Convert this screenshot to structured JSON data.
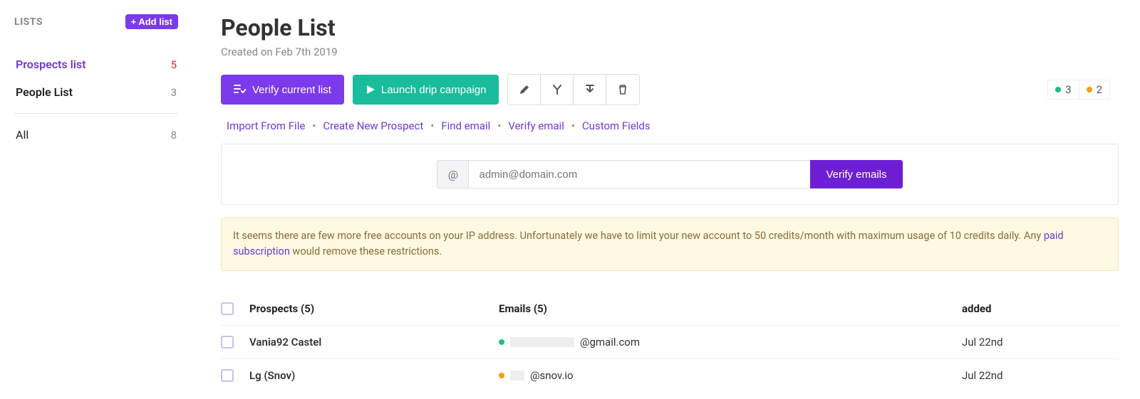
{
  "sidebar": {
    "title": "LISTS",
    "add_button": "+ Add list",
    "lists": [
      {
        "label": "Prospects list",
        "count": "5",
        "active": true
      },
      {
        "label": "People List",
        "count": "3",
        "active": false
      }
    ],
    "all_label": "All",
    "all_count": "8"
  },
  "page": {
    "title": "People List",
    "subtitle": "Created on Feb 7th 2019"
  },
  "toolbar": {
    "verify_label": "Verify current list",
    "launch_label": "Launch drip campaign"
  },
  "status_badges": {
    "green": "3",
    "orange": "2"
  },
  "sub_links": [
    "Import From File",
    "Create New Prospect",
    "Find email",
    "Verify email",
    "Custom Fields"
  ],
  "verify_box": {
    "at": "@",
    "placeholder": "admin@domain.com",
    "button": "Verify emails"
  },
  "alert": {
    "before_link": "It seems there are few more free accounts on your IP address. Unfortunately we have to limit your new account to 50 credits/month with maximum usage of 10 credits daily. Any ",
    "link_text": "paid subscription",
    "after_link": " would remove these restrictions."
  },
  "table": {
    "header": {
      "prospects": "Prospects (5)",
      "emails": "Emails (5)",
      "added": "added"
    },
    "rows": [
      {
        "name": "Vania92 Castel",
        "email_suffix": "@gmail.com",
        "status": "green",
        "added": "Jul 22nd"
      },
      {
        "name": "Lg (Snov)",
        "email_suffix": "@snov.io",
        "status": "orange",
        "added": "Jul 22nd"
      }
    ]
  }
}
